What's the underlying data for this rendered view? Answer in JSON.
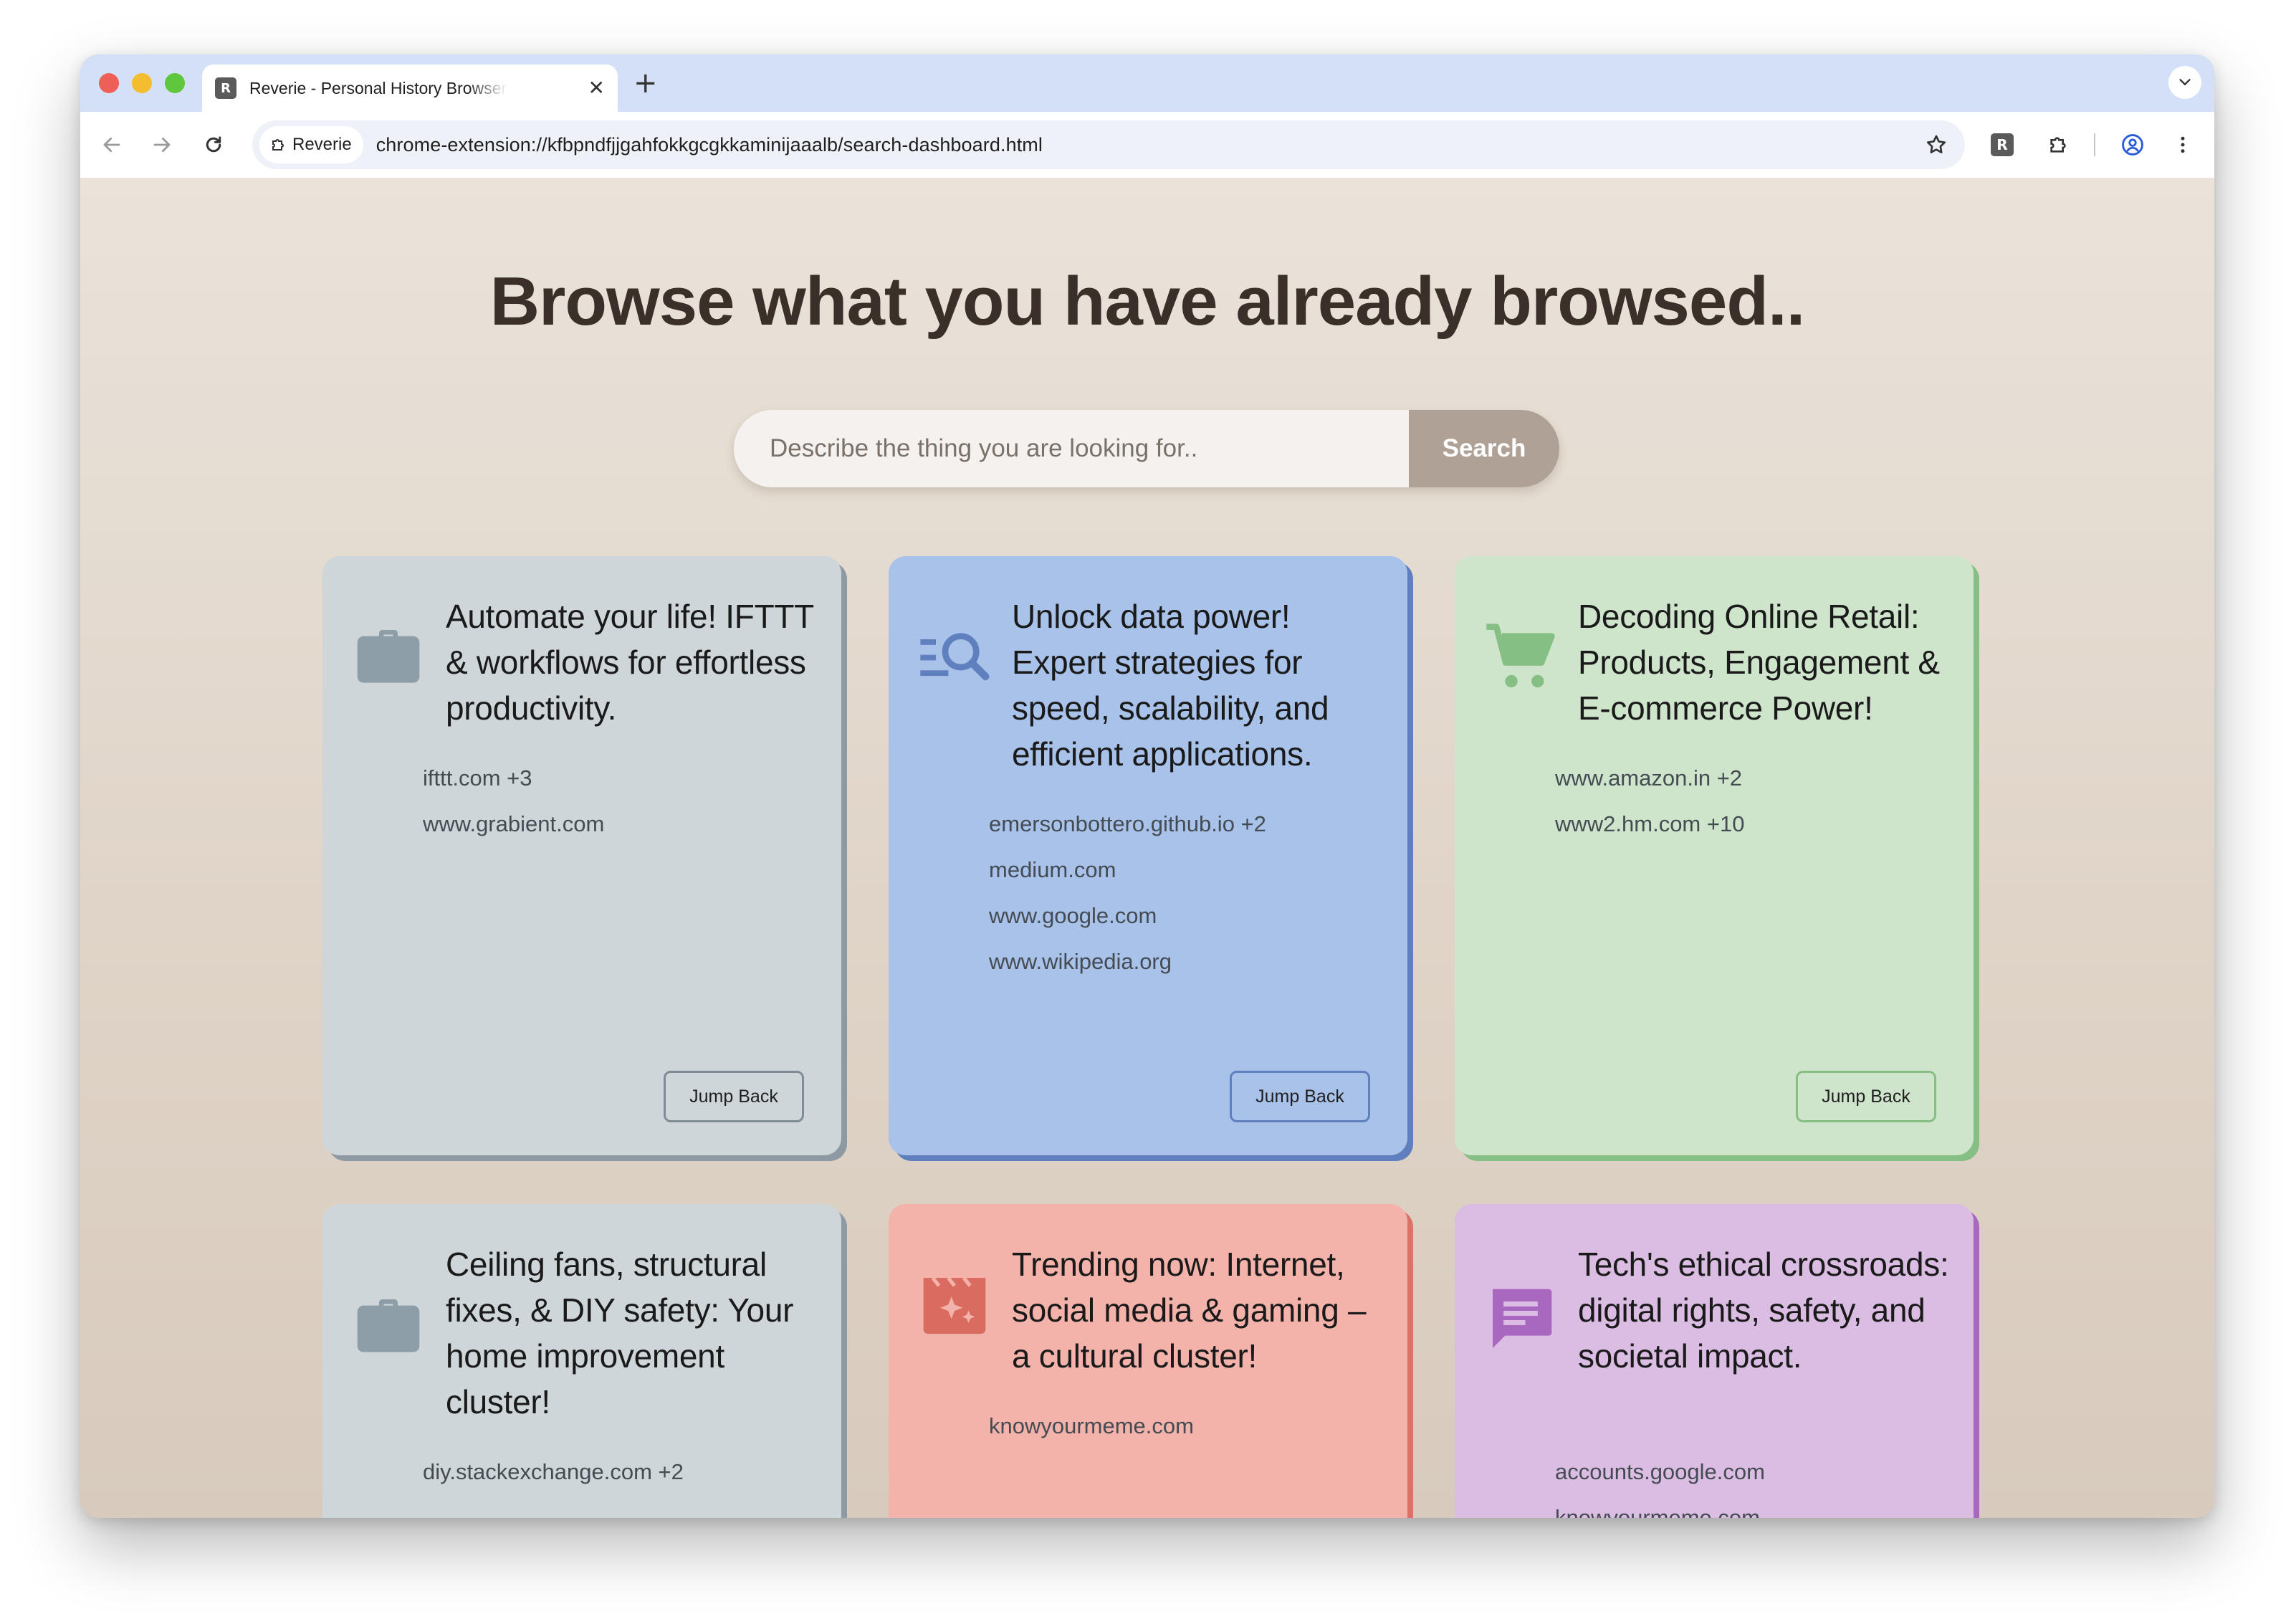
{
  "browser": {
    "tab": {
      "favicon_letter": "R",
      "title": "Reverie - Personal History Browser"
    },
    "omnibox": {
      "site_chip": "Reverie",
      "url": "chrome-extension://kfbpndfjjgahfokkgcgkkaminijaaalb/search-dashboard.html"
    },
    "extension_letter": "R"
  },
  "page": {
    "headline": "Browse what you have already browsed..",
    "search": {
      "placeholder": "Describe the thing you are looking for..",
      "button_label": "Search"
    },
    "cards": [
      {
        "icon": "briefcase-icon",
        "title": "Automate your life! IFTTT & workflows for effortless productivity.",
        "domains": [
          "ifttt.com +3",
          "www.grabient.com"
        ],
        "button_label": "Jump Back",
        "color": "#cfd6da"
      },
      {
        "icon": "search-list-icon",
        "title": "Unlock data power! Expert strategies for speed, scalability, and efficient applications.",
        "domains": [
          "emersonbottero.github.io +2",
          "medium.com",
          "www.google.com",
          "www.wikipedia.org"
        ],
        "button_label": "Jump Back",
        "color": "#a9c2e9"
      },
      {
        "icon": "shopping-cart-icon",
        "title": "Decoding Online Retail: Products, Engagement & E-commerce Power!",
        "domains": [
          "www.amazon.in +2",
          "www2.hm.com +10"
        ],
        "button_label": "Jump Back",
        "color": "#cee4cb"
      },
      {
        "icon": "briefcase-icon",
        "title": "Ceiling fans, structural fixes, & DIY safety: Your home improvement cluster!",
        "domains": [
          "diy.stackexchange.com +2"
        ],
        "color": "#cfd6da"
      },
      {
        "icon": "clapperboard-icon",
        "title": "Trending now: Internet, social media & gaming – a cultural cluster!",
        "domains": [
          "knowyourmeme.com"
        ],
        "color": "#f4b3aa"
      },
      {
        "icon": "chat-message-icon",
        "title": "Tech's ethical crossroads: digital rights, safety, and societal impact.",
        "domains": [
          "accounts.google.com",
          "knowyourmeme.com"
        ],
        "color": "#dbbde4"
      }
    ]
  }
}
